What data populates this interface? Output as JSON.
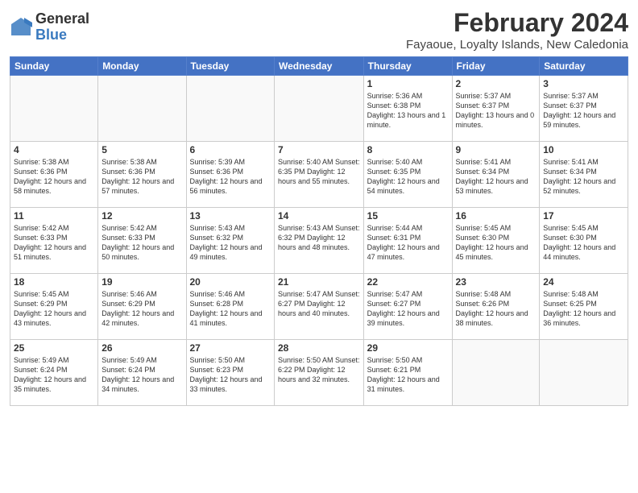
{
  "logo": {
    "general": "General",
    "blue": "Blue"
  },
  "title": {
    "month_year": "February 2024",
    "location": "Fayaoue, Loyalty Islands, New Caledonia"
  },
  "headers": [
    "Sunday",
    "Monday",
    "Tuesday",
    "Wednesday",
    "Thursday",
    "Friday",
    "Saturday"
  ],
  "weeks": [
    [
      {
        "day": "",
        "info": ""
      },
      {
        "day": "",
        "info": ""
      },
      {
        "day": "",
        "info": ""
      },
      {
        "day": "",
        "info": ""
      },
      {
        "day": "1",
        "info": "Sunrise: 5:36 AM\nSunset: 6:38 PM\nDaylight: 13 hours\nand 1 minute."
      },
      {
        "day": "2",
        "info": "Sunrise: 5:37 AM\nSunset: 6:37 PM\nDaylight: 13 hours\nand 0 minutes."
      },
      {
        "day": "3",
        "info": "Sunrise: 5:37 AM\nSunset: 6:37 PM\nDaylight: 12 hours\nand 59 minutes."
      }
    ],
    [
      {
        "day": "4",
        "info": "Sunrise: 5:38 AM\nSunset: 6:36 PM\nDaylight: 12 hours\nand 58 minutes."
      },
      {
        "day": "5",
        "info": "Sunrise: 5:38 AM\nSunset: 6:36 PM\nDaylight: 12 hours\nand 57 minutes."
      },
      {
        "day": "6",
        "info": "Sunrise: 5:39 AM\nSunset: 6:36 PM\nDaylight: 12 hours\nand 56 minutes."
      },
      {
        "day": "7",
        "info": "Sunrise: 5:40 AM\nSunset: 6:35 PM\nDaylight: 12 hours\nand 55 minutes."
      },
      {
        "day": "8",
        "info": "Sunrise: 5:40 AM\nSunset: 6:35 PM\nDaylight: 12 hours\nand 54 minutes."
      },
      {
        "day": "9",
        "info": "Sunrise: 5:41 AM\nSunset: 6:34 PM\nDaylight: 12 hours\nand 53 minutes."
      },
      {
        "day": "10",
        "info": "Sunrise: 5:41 AM\nSunset: 6:34 PM\nDaylight: 12 hours\nand 52 minutes."
      }
    ],
    [
      {
        "day": "11",
        "info": "Sunrise: 5:42 AM\nSunset: 6:33 PM\nDaylight: 12 hours\nand 51 minutes."
      },
      {
        "day": "12",
        "info": "Sunrise: 5:42 AM\nSunset: 6:33 PM\nDaylight: 12 hours\nand 50 minutes."
      },
      {
        "day": "13",
        "info": "Sunrise: 5:43 AM\nSunset: 6:32 PM\nDaylight: 12 hours\nand 49 minutes."
      },
      {
        "day": "14",
        "info": "Sunrise: 5:43 AM\nSunset: 6:32 PM\nDaylight: 12 hours\nand 48 minutes."
      },
      {
        "day": "15",
        "info": "Sunrise: 5:44 AM\nSunset: 6:31 PM\nDaylight: 12 hours\nand 47 minutes."
      },
      {
        "day": "16",
        "info": "Sunrise: 5:45 AM\nSunset: 6:30 PM\nDaylight: 12 hours\nand 45 minutes."
      },
      {
        "day": "17",
        "info": "Sunrise: 5:45 AM\nSunset: 6:30 PM\nDaylight: 12 hours\nand 44 minutes."
      }
    ],
    [
      {
        "day": "18",
        "info": "Sunrise: 5:45 AM\nSunset: 6:29 PM\nDaylight: 12 hours\nand 43 minutes."
      },
      {
        "day": "19",
        "info": "Sunrise: 5:46 AM\nSunset: 6:29 PM\nDaylight: 12 hours\nand 42 minutes."
      },
      {
        "day": "20",
        "info": "Sunrise: 5:46 AM\nSunset: 6:28 PM\nDaylight: 12 hours\nand 41 minutes."
      },
      {
        "day": "21",
        "info": "Sunrise: 5:47 AM\nSunset: 6:27 PM\nDaylight: 12 hours\nand 40 minutes."
      },
      {
        "day": "22",
        "info": "Sunrise: 5:47 AM\nSunset: 6:27 PM\nDaylight: 12 hours\nand 39 minutes."
      },
      {
        "day": "23",
        "info": "Sunrise: 5:48 AM\nSunset: 6:26 PM\nDaylight: 12 hours\nand 38 minutes."
      },
      {
        "day": "24",
        "info": "Sunrise: 5:48 AM\nSunset: 6:25 PM\nDaylight: 12 hours\nand 36 minutes."
      }
    ],
    [
      {
        "day": "25",
        "info": "Sunrise: 5:49 AM\nSunset: 6:24 PM\nDaylight: 12 hours\nand 35 minutes."
      },
      {
        "day": "26",
        "info": "Sunrise: 5:49 AM\nSunset: 6:24 PM\nDaylight: 12 hours\nand 34 minutes."
      },
      {
        "day": "27",
        "info": "Sunrise: 5:50 AM\nSunset: 6:23 PM\nDaylight: 12 hours\nand 33 minutes."
      },
      {
        "day": "28",
        "info": "Sunrise: 5:50 AM\nSunset: 6:22 PM\nDaylight: 12 hours\nand 32 minutes."
      },
      {
        "day": "29",
        "info": "Sunrise: 5:50 AM\nSunset: 6:21 PM\nDaylight: 12 hours\nand 31 minutes."
      },
      {
        "day": "",
        "info": ""
      },
      {
        "day": "",
        "info": ""
      }
    ]
  ]
}
